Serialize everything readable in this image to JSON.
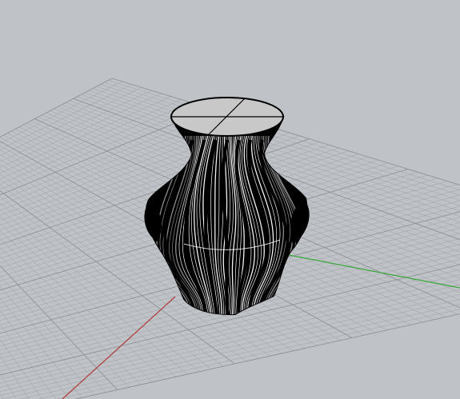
{
  "viewport": {
    "background_color": "#bfc2c6",
    "grid_color": "#9ea2a7",
    "grid_major_color": "#8e9297",
    "x_axis_color": "#b03a3a",
    "y_axis_color": "#3aa63a"
  },
  "model": {
    "object_type": "vase",
    "display_mode": "wireframe",
    "surface_color": "#000000",
    "isocurve_color": "#ffffff",
    "top_cap_color": "#c8c8c8"
  }
}
